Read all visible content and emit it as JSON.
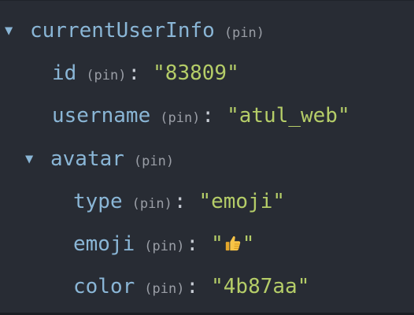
{
  "tree": {
    "root": {
      "key": "currentUserInfo",
      "pin": "(pin)",
      "expanded": true,
      "children": {
        "id": {
          "key": "id",
          "pin": "(pin)",
          "value": "\"83809\""
        },
        "username": {
          "key": "username",
          "pin": "(pin)",
          "value": "\"atul_web\""
        },
        "avatar": {
          "key": "avatar",
          "pin": "(pin)",
          "expanded": true,
          "children": {
            "type": {
              "key": "type",
              "pin": "(pin)",
              "value": "\"emoji\""
            },
            "emoji": {
              "key": "emoji",
              "pin": "(pin)",
              "value_open": "\"",
              "value_close": "\"",
              "icon": "thumbs-up-emoji"
            },
            "color": {
              "key": "color",
              "pin": "(pin)",
              "value": "\"4b87aa\""
            }
          }
        }
      }
    },
    "colon": ":",
    "toggle_glyph": "▼"
  },
  "colors": {
    "background": "#282c34",
    "key": "#8ab6d6",
    "pin": "#9a9ea6",
    "value": "#b5cd68",
    "punctuation": "#c7ccd4"
  }
}
